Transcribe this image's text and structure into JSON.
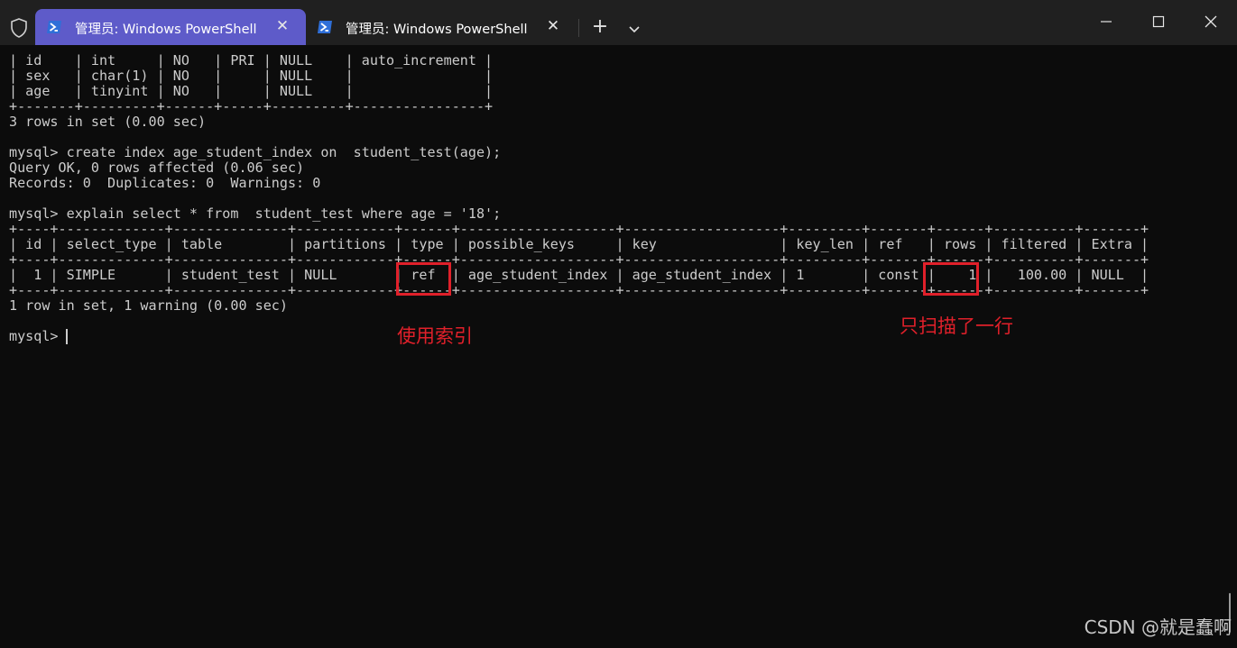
{
  "titlebar": {
    "tabs": [
      {
        "title": "管理员: Windows PowerShell",
        "active": true
      },
      {
        "title": "管理员: Windows PowerShell",
        "active": false
      }
    ],
    "icons": {
      "shield": "shield-icon",
      "tab_icon": "powershell-icon",
      "close": "close-icon",
      "new_tab": "plus-icon",
      "dropdown": "chevron-down-icon",
      "minimize": "minimize-icon",
      "maximize": "maximize-icon",
      "window_close": "close-icon"
    },
    "close_glyph": "✕",
    "new_tab_glyph": "+"
  },
  "terminal": {
    "lines": [
      "| id    | int     | NO   | PRI | NULL    | auto_increment |",
      "| sex   | char(1) | NO   |     | NULL    |                |",
      "| age   | tinyint | NO   |     | NULL    |                |",
      "+-------+---------+------+-----+---------+----------------+",
      "3 rows in set (0.00 sec)",
      "",
      "mysql> create index age_student_index on  student_test(age);",
      "Query OK, 0 rows affected (0.06 sec)",
      "Records: 0  Duplicates: 0  Warnings: 0",
      "",
      "mysql> explain select * from  student_test where age = '18';",
      "+----+-------------+--------------+------------+------+-------------------+-------------------+---------+-------+------+----------+-------+",
      "| id | select_type | table        | partitions | type | possible_keys     | key               | key_len | ref   | rows | filtered | Extra |",
      "+----+-------------+--------------+------------+------+-------------------+-------------------+---------+-------+------+----------+-------+",
      "|  1 | SIMPLE      | student_test | NULL       | ref  | age_student_index | age_student_index | 1       | const |    1 |   100.00 | NULL  |",
      "+----+-------------+--------------+------------+------+-------------------+-------------------+---------+-------+------+----------+-------+",
      "1 row in set, 1 warning (0.00 sec)",
      "",
      "mysql> "
    ],
    "colors": {
      "background": "#0c0c0c",
      "foreground": "#cccccc",
      "annotation": "#e0202a",
      "active_tab": "#5e5bc9"
    }
  },
  "annotations": {
    "type_note": "使用索引",
    "rows_note": "只扫描了一行"
  },
  "watermark": "CSDN @就是蠢啊"
}
